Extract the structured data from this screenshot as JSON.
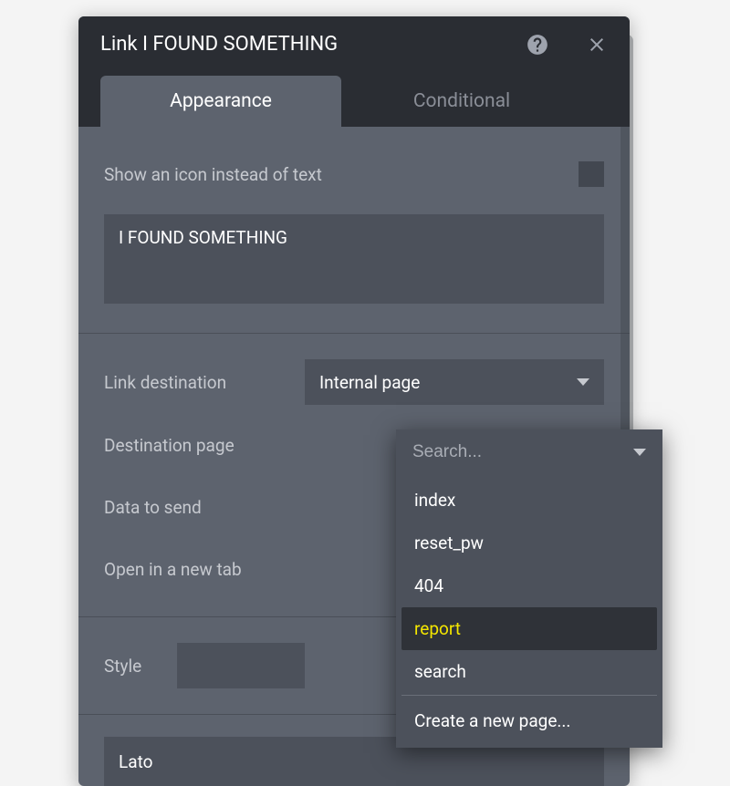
{
  "header": {
    "title": "Link I FOUND SOMETHING"
  },
  "tabs": {
    "appearance": "Appearance",
    "conditional": "Conditional"
  },
  "iconTextRow": {
    "label": "Show an icon instead of text"
  },
  "textValue": "I FOUND SOMETHING",
  "linkDestination": {
    "label": "Link destination",
    "value": "Internal page"
  },
  "destinationPage": {
    "label": "Destination page",
    "searchPlaceholder": "Search...",
    "options": [
      "index",
      "reset_pw",
      "404",
      "report",
      "search"
    ],
    "highlighted": "report",
    "createNew": "Create a new page..."
  },
  "dataToSend": {
    "label": "Data to send"
  },
  "openNewTab": {
    "label": "Open in a new tab"
  },
  "style": {
    "label": "Style"
  },
  "font": {
    "value": "Lato"
  }
}
